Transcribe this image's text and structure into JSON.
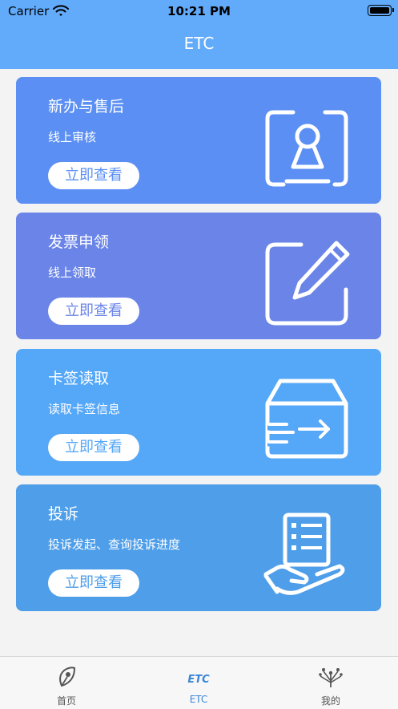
{
  "status_bar": {
    "carrier": "Carrier",
    "time": "10:21 PM"
  },
  "nav": {
    "title": "ETC"
  },
  "colors": {
    "header": "#62abfb",
    "card1": "#5b8ff3",
    "card2": "#6a84e8",
    "card3": "#55a7f7",
    "card4": "#4e9ee9"
  },
  "cards": [
    {
      "title": "新办与售后",
      "subtitle": "线上审核",
      "button": "立即查看",
      "icon": "id-card-person-icon"
    },
    {
      "title": "发票申领",
      "subtitle": "线上领取",
      "button": "立即查看",
      "icon": "edit-pencil-icon"
    },
    {
      "title": "卡签读取",
      "subtitle": "读取卡签信息",
      "button": "立即查看",
      "icon": "box-read-arrow-icon"
    },
    {
      "title": "投诉",
      "subtitle": "投诉发起、查询投诉进度",
      "button": "立即查看",
      "icon": "hand-document-icon"
    }
  ],
  "tabbar": {
    "tabs": [
      {
        "label": "首页",
        "icon": "home-leaf-icon",
        "active": false
      },
      {
        "label": "ETC",
        "icon": "etc-icon",
        "icon_text": "ETC",
        "active": true
      },
      {
        "label": "我的",
        "icon": "profile-branches-icon",
        "active": false
      }
    ]
  }
}
